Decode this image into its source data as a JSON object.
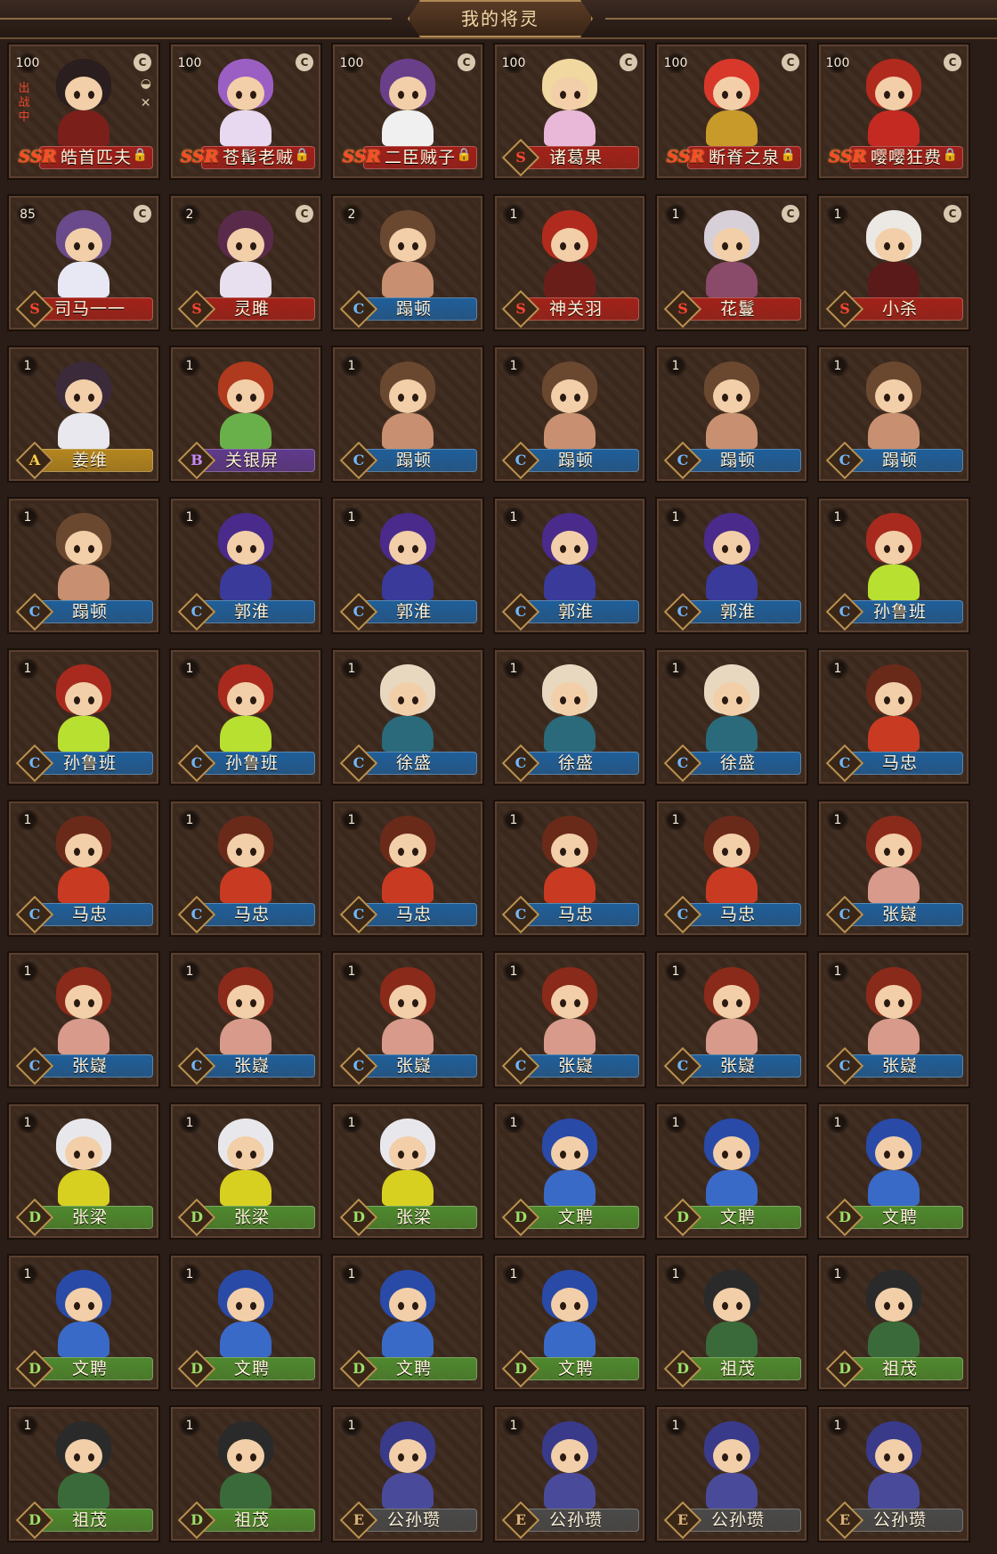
{
  "title": "我的将灵",
  "colors": {
    "SSR": "#a21f1a",
    "S": "#a32219",
    "A": "#b5871f",
    "B": "#5f3a8c",
    "C": "#1f5f9a",
    "D": "#4e8a2e",
    "E": "#4a4a4a"
  },
  "grade_text_colors": {
    "S": "#ff4433",
    "A": "#ffd146",
    "B": "#c58cff",
    "C": "#6fb8ff",
    "D": "#9be06a",
    "E": "#d7b27a"
  },
  "cards": [
    {
      "level": "100",
      "grade": "SSR",
      "name": "皓首匹夫",
      "locked": true,
      "currency": true,
      "deployed": "出战中",
      "extra_icons": true,
      "hair": "#2b1e1e",
      "body": "#7a1f1a"
    },
    {
      "level": "100",
      "grade": "SSR",
      "name": "苍髯老贼",
      "locked": true,
      "currency": true,
      "hair": "#9b5fc4",
      "body": "#e8d8f0"
    },
    {
      "level": "100",
      "grade": "SSR",
      "name": "二臣贼子",
      "locked": true,
      "currency": true,
      "hair": "#6a3f8a",
      "body": "#f0f0f0"
    },
    {
      "level": "100",
      "grade": "S",
      "name": "诸葛果",
      "locked": false,
      "currency": true,
      "hair": "#f0d8a0",
      "body": "#e9b8d8"
    },
    {
      "level": "100",
      "grade": "SSR",
      "name": "断脊之泉",
      "locked": true,
      "currency": true,
      "hair": "#d8382a",
      "body": "#c89a2a"
    },
    {
      "level": "100",
      "grade": "SSR",
      "name": "嘤嘤狂费",
      "locked": true,
      "currency": true,
      "hair": "#b02a1e",
      "body": "#c42a22"
    },
    {
      "level": "85",
      "grade": "S",
      "name": "司马一一",
      "locked": false,
      "currency": true,
      "hair": "#6a4a8a",
      "body": "#e8e8f4"
    },
    {
      "level": "2",
      "grade": "S",
      "name": "灵雎",
      "locked": false,
      "currency": true,
      "hair": "#5a2a4a",
      "body": "#e8e0ee"
    },
    {
      "level": "2",
      "grade": "C",
      "name": "蹋顿",
      "locked": false,
      "currency": false,
      "hair": "#6a4830",
      "body": "#c89070"
    },
    {
      "level": "1",
      "grade": "S",
      "name": "神关羽",
      "locked": false,
      "currency": false,
      "hair": "#b02a1e",
      "body": "#6a1e1a"
    },
    {
      "level": "1",
      "grade": "S",
      "name": "花鬘",
      "locked": false,
      "currency": true,
      "hair": "#d8d0d8",
      "body": "#8a4a6a"
    },
    {
      "level": "1",
      "grade": "S",
      "name": "小杀",
      "locked": false,
      "currency": true,
      "hair": "#ece8e4",
      "body": "#5a1a1a"
    },
    {
      "level": "1",
      "grade": "A",
      "name": "姜维",
      "locked": false,
      "currency": false,
      "hair": "#3a2a3a",
      "body": "#e8e8ee"
    },
    {
      "level": "1",
      "grade": "B",
      "name": "关银屏",
      "locked": false,
      "currency": false,
      "hair": "#b03a1e",
      "body": "#6ab04a"
    },
    {
      "level": "1",
      "grade": "C",
      "name": "蹋顿",
      "locked": false,
      "currency": false,
      "hair": "#6a4830",
      "body": "#c89070"
    },
    {
      "level": "1",
      "grade": "C",
      "name": "蹋顿",
      "locked": false,
      "currency": false,
      "hair": "#6a4830",
      "body": "#c89070"
    },
    {
      "level": "1",
      "grade": "C",
      "name": "蹋顿",
      "locked": false,
      "currency": false,
      "hair": "#6a4830",
      "body": "#c89070"
    },
    {
      "level": "1",
      "grade": "C",
      "name": "蹋顿",
      "locked": false,
      "currency": false,
      "hair": "#6a4830",
      "body": "#c89070"
    },
    {
      "level": "1",
      "grade": "C",
      "name": "蹋顿",
      "locked": false,
      "currency": false,
      "hair": "#6a4830",
      "body": "#c89070"
    },
    {
      "level": "1",
      "grade": "C",
      "name": "郭淮",
      "locked": false,
      "currency": false,
      "hair": "#4a2a8a",
      "body": "#3a3a9a"
    },
    {
      "level": "1",
      "grade": "C",
      "name": "郭淮",
      "locked": false,
      "currency": false,
      "hair": "#4a2a8a",
      "body": "#3a3a9a"
    },
    {
      "level": "1",
      "grade": "C",
      "name": "郭淮",
      "locked": false,
      "currency": false,
      "hair": "#4a2a8a",
      "body": "#3a3a9a"
    },
    {
      "level": "1",
      "grade": "C",
      "name": "郭淮",
      "locked": false,
      "currency": false,
      "hair": "#4a2a8a",
      "body": "#3a3a9a"
    },
    {
      "level": "1",
      "grade": "C",
      "name": "孙鲁班",
      "locked": false,
      "currency": false,
      "hair": "#a82a1e",
      "body": "#b8e030"
    },
    {
      "level": "1",
      "grade": "C",
      "name": "孙鲁班",
      "locked": false,
      "currency": false,
      "hair": "#a82a1e",
      "body": "#b8e030"
    },
    {
      "level": "1",
      "grade": "C",
      "name": "孙鲁班",
      "locked": false,
      "currency": false,
      "hair": "#a82a1e",
      "body": "#b8e030"
    },
    {
      "level": "1",
      "grade": "C",
      "name": "徐盛",
      "locked": false,
      "currency": false,
      "hair": "#e8d8c0",
      "body": "#2a6a7a"
    },
    {
      "level": "1",
      "grade": "C",
      "name": "徐盛",
      "locked": false,
      "currency": false,
      "hair": "#e8d8c0",
      "body": "#2a6a7a"
    },
    {
      "level": "1",
      "grade": "C",
      "name": "徐盛",
      "locked": false,
      "currency": false,
      "hair": "#e8d8c0",
      "body": "#2a6a7a"
    },
    {
      "level": "1",
      "grade": "C",
      "name": "马忠",
      "locked": false,
      "currency": false,
      "hair": "#6a2a1a",
      "body": "#c83a22"
    },
    {
      "level": "1",
      "grade": "C",
      "name": "马忠",
      "locked": false,
      "currency": false,
      "hair": "#6a2a1a",
      "body": "#c83a22"
    },
    {
      "level": "1",
      "grade": "C",
      "name": "马忠",
      "locked": false,
      "currency": false,
      "hair": "#6a2a1a",
      "body": "#c83a22"
    },
    {
      "level": "1",
      "grade": "C",
      "name": "马忠",
      "locked": false,
      "currency": false,
      "hair": "#6a2a1a",
      "body": "#c83a22"
    },
    {
      "level": "1",
      "grade": "C",
      "name": "马忠",
      "locked": false,
      "currency": false,
      "hair": "#6a2a1a",
      "body": "#c83a22"
    },
    {
      "level": "1",
      "grade": "C",
      "name": "马忠",
      "locked": false,
      "currency": false,
      "hair": "#6a2a1a",
      "body": "#c83a22"
    },
    {
      "level": "1",
      "grade": "C",
      "name": "张嶷",
      "locked": false,
      "currency": false,
      "hair": "#8a2a1a",
      "body": "#d89a8a"
    },
    {
      "level": "1",
      "grade": "C",
      "name": "张嶷",
      "locked": false,
      "currency": false,
      "hair": "#8a2a1a",
      "body": "#d89a8a"
    },
    {
      "level": "1",
      "grade": "C",
      "name": "张嶷",
      "locked": false,
      "currency": false,
      "hair": "#8a2a1a",
      "body": "#d89a8a"
    },
    {
      "level": "1",
      "grade": "C",
      "name": "张嶷",
      "locked": false,
      "currency": false,
      "hair": "#8a2a1a",
      "body": "#d89a8a"
    },
    {
      "level": "1",
      "grade": "C",
      "name": "张嶷",
      "locked": false,
      "currency": false,
      "hair": "#8a2a1a",
      "body": "#d89a8a"
    },
    {
      "level": "1",
      "grade": "C",
      "name": "张嶷",
      "locked": false,
      "currency": false,
      "hair": "#8a2a1a",
      "body": "#d89a8a"
    },
    {
      "level": "1",
      "grade": "C",
      "name": "张嶷",
      "locked": false,
      "currency": false,
      "hair": "#8a2a1a",
      "body": "#d89a8a"
    },
    {
      "level": "1",
      "grade": "D",
      "name": "张梁",
      "locked": false,
      "currency": false,
      "hair": "#e8e8ec",
      "body": "#d8d020"
    },
    {
      "level": "1",
      "grade": "D",
      "name": "张梁",
      "locked": false,
      "currency": false,
      "hair": "#e8e8ec",
      "body": "#d8d020"
    },
    {
      "level": "1",
      "grade": "D",
      "name": "张梁",
      "locked": false,
      "currency": false,
      "hair": "#e8e8ec",
      "body": "#d8d020"
    },
    {
      "level": "1",
      "grade": "D",
      "name": "文聘",
      "locked": false,
      "currency": false,
      "hair": "#2a4aa8",
      "body": "#3a6ac8"
    },
    {
      "level": "1",
      "grade": "D",
      "name": "文聘",
      "locked": false,
      "currency": false,
      "hair": "#2a4aa8",
      "body": "#3a6ac8"
    },
    {
      "level": "1",
      "grade": "D",
      "name": "文聘",
      "locked": false,
      "currency": false,
      "hair": "#2a4aa8",
      "body": "#3a6ac8"
    },
    {
      "level": "1",
      "grade": "D",
      "name": "文聘",
      "locked": false,
      "currency": false,
      "hair": "#2a4aa8",
      "body": "#3a6ac8"
    },
    {
      "level": "1",
      "grade": "D",
      "name": "文聘",
      "locked": false,
      "currency": false,
      "hair": "#2a4aa8",
      "body": "#3a6ac8"
    },
    {
      "level": "1",
      "grade": "D",
      "name": "文聘",
      "locked": false,
      "currency": false,
      "hair": "#2a4aa8",
      "body": "#3a6ac8"
    },
    {
      "level": "1",
      "grade": "D",
      "name": "文聘",
      "locked": false,
      "currency": false,
      "hair": "#2a4aa8",
      "body": "#3a6ac8"
    },
    {
      "level": "1",
      "grade": "D",
      "name": "祖茂",
      "locked": false,
      "currency": false,
      "hair": "#2a2a2a",
      "body": "#3a6a3a"
    },
    {
      "level": "1",
      "grade": "D",
      "name": "祖茂",
      "locked": false,
      "currency": false,
      "hair": "#2a2a2a",
      "body": "#3a6a3a"
    },
    {
      "level": "1",
      "grade": "D",
      "name": "祖茂",
      "locked": false,
      "currency": false,
      "hair": "#2a2a2a",
      "body": "#3a6a3a"
    },
    {
      "level": "1",
      "grade": "D",
      "name": "祖茂",
      "locked": false,
      "currency": false,
      "hair": "#2a2a2a",
      "body": "#3a6a3a"
    },
    {
      "level": "1",
      "grade": "E",
      "name": "公孙瓒",
      "locked": false,
      "currency": false,
      "hair": "#3a3a8a",
      "body": "#4a4a9a"
    },
    {
      "level": "1",
      "grade": "E",
      "name": "公孙瓒",
      "locked": false,
      "currency": false,
      "hair": "#3a3a8a",
      "body": "#4a4a9a"
    },
    {
      "level": "1",
      "grade": "E",
      "name": "公孙瓒",
      "locked": false,
      "currency": false,
      "hair": "#3a3a8a",
      "body": "#4a4a9a"
    },
    {
      "level": "1",
      "grade": "E",
      "name": "公孙瓒",
      "locked": false,
      "currency": false,
      "hair": "#3a3a8a",
      "body": "#4a4a9a"
    }
  ]
}
